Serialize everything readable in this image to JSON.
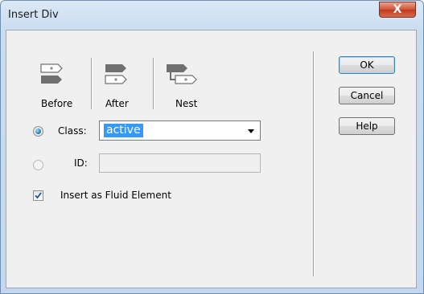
{
  "window": {
    "title": "Insert Div",
    "close_glyph": "X"
  },
  "placement": [
    {
      "label": "Before",
      "icon": "insert-before-icon"
    },
    {
      "label": "After",
      "icon": "insert-after-icon"
    },
    {
      "label": "Nest",
      "icon": "insert-nest-icon"
    }
  ],
  "class_field": {
    "label": "Class:",
    "value": "active",
    "selected": true
  },
  "id_field": {
    "label": "ID:",
    "value": "",
    "selected": false
  },
  "fluid": {
    "label": "Insert as Fluid Element",
    "checked": true
  },
  "buttons": {
    "ok": "OK",
    "cancel": "Cancel",
    "help": "Help"
  },
  "colors": {
    "selection": "#3399ff",
    "icon": "#707070"
  }
}
